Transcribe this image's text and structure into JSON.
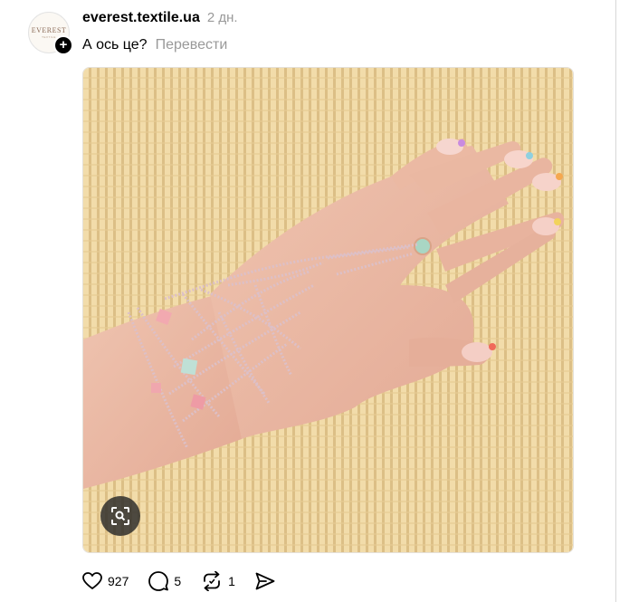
{
  "post": {
    "username": "everest.textile.ua",
    "time_ago": "2 дн.",
    "caption": "А ось це?",
    "translate_label": "Перевести",
    "avatar_text": "EVEREST",
    "avatar_subtext": "TEXTILE"
  },
  "stats": {
    "likes": "927",
    "comments": "5",
    "reposts": "1"
  },
  "icons": {
    "follow": "plus-icon",
    "lens": "visual-search-icon",
    "like": "heart-icon",
    "comment": "comment-icon",
    "repost": "repost-icon",
    "share": "send-icon"
  },
  "colors": {
    "secondary_text": "#999999",
    "mat_background": "#f1d9a6"
  }
}
